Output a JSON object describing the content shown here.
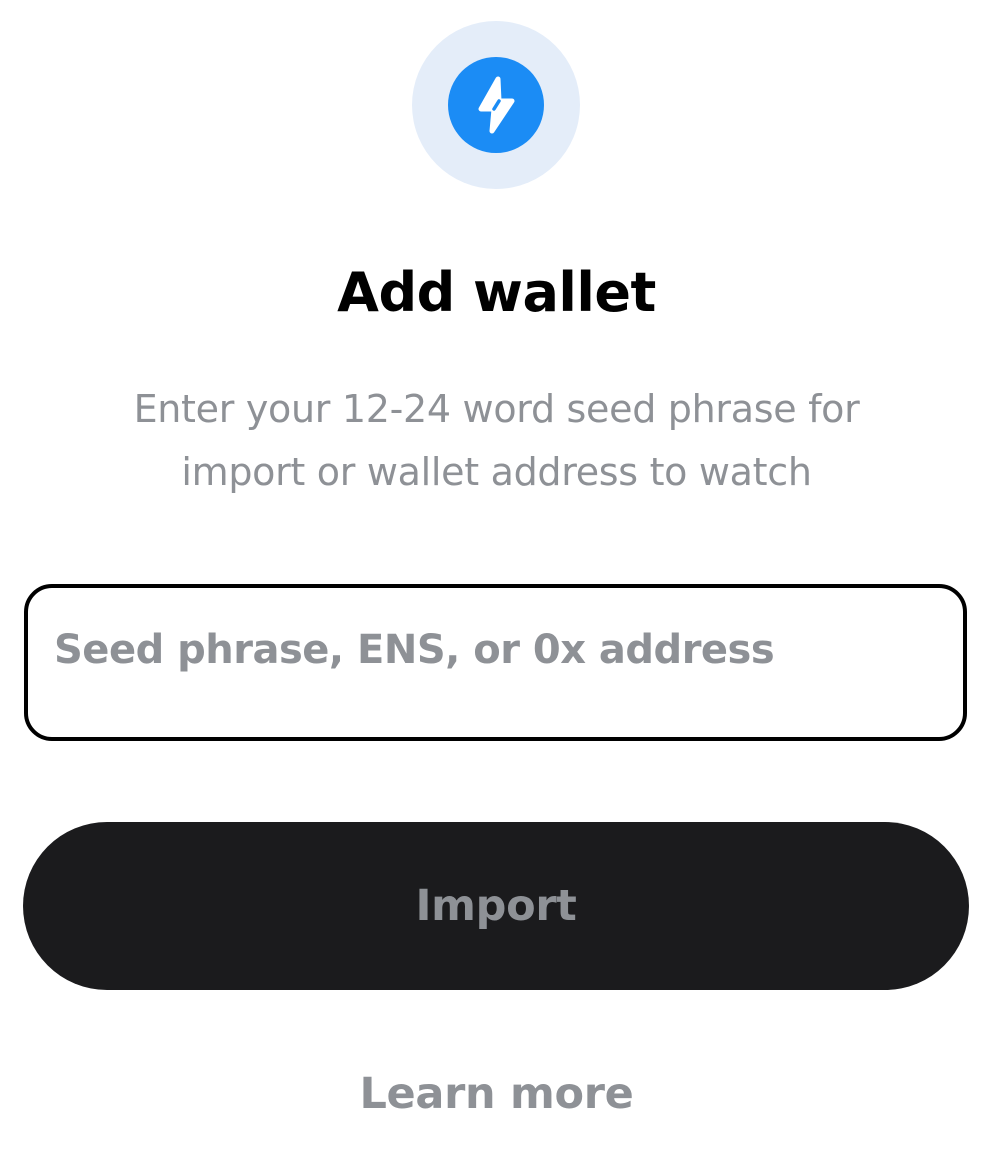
{
  "icon": {
    "name": "lightning-bolt-icon",
    "disc_color": "#1b8cf5",
    "halo_color": "#e4edf9"
  },
  "title": "Add wallet",
  "subtitle": {
    "line1": "Enter your 12-24 word seed phrase for",
    "line2": "import or wallet address to watch"
  },
  "input": {
    "value": "",
    "placeholder": "Seed phrase, ENS, or 0x address"
  },
  "import_button": {
    "label": "Import",
    "background": "#1b1b1d",
    "text_color": "#8e9196"
  },
  "learn_more": "Learn more"
}
